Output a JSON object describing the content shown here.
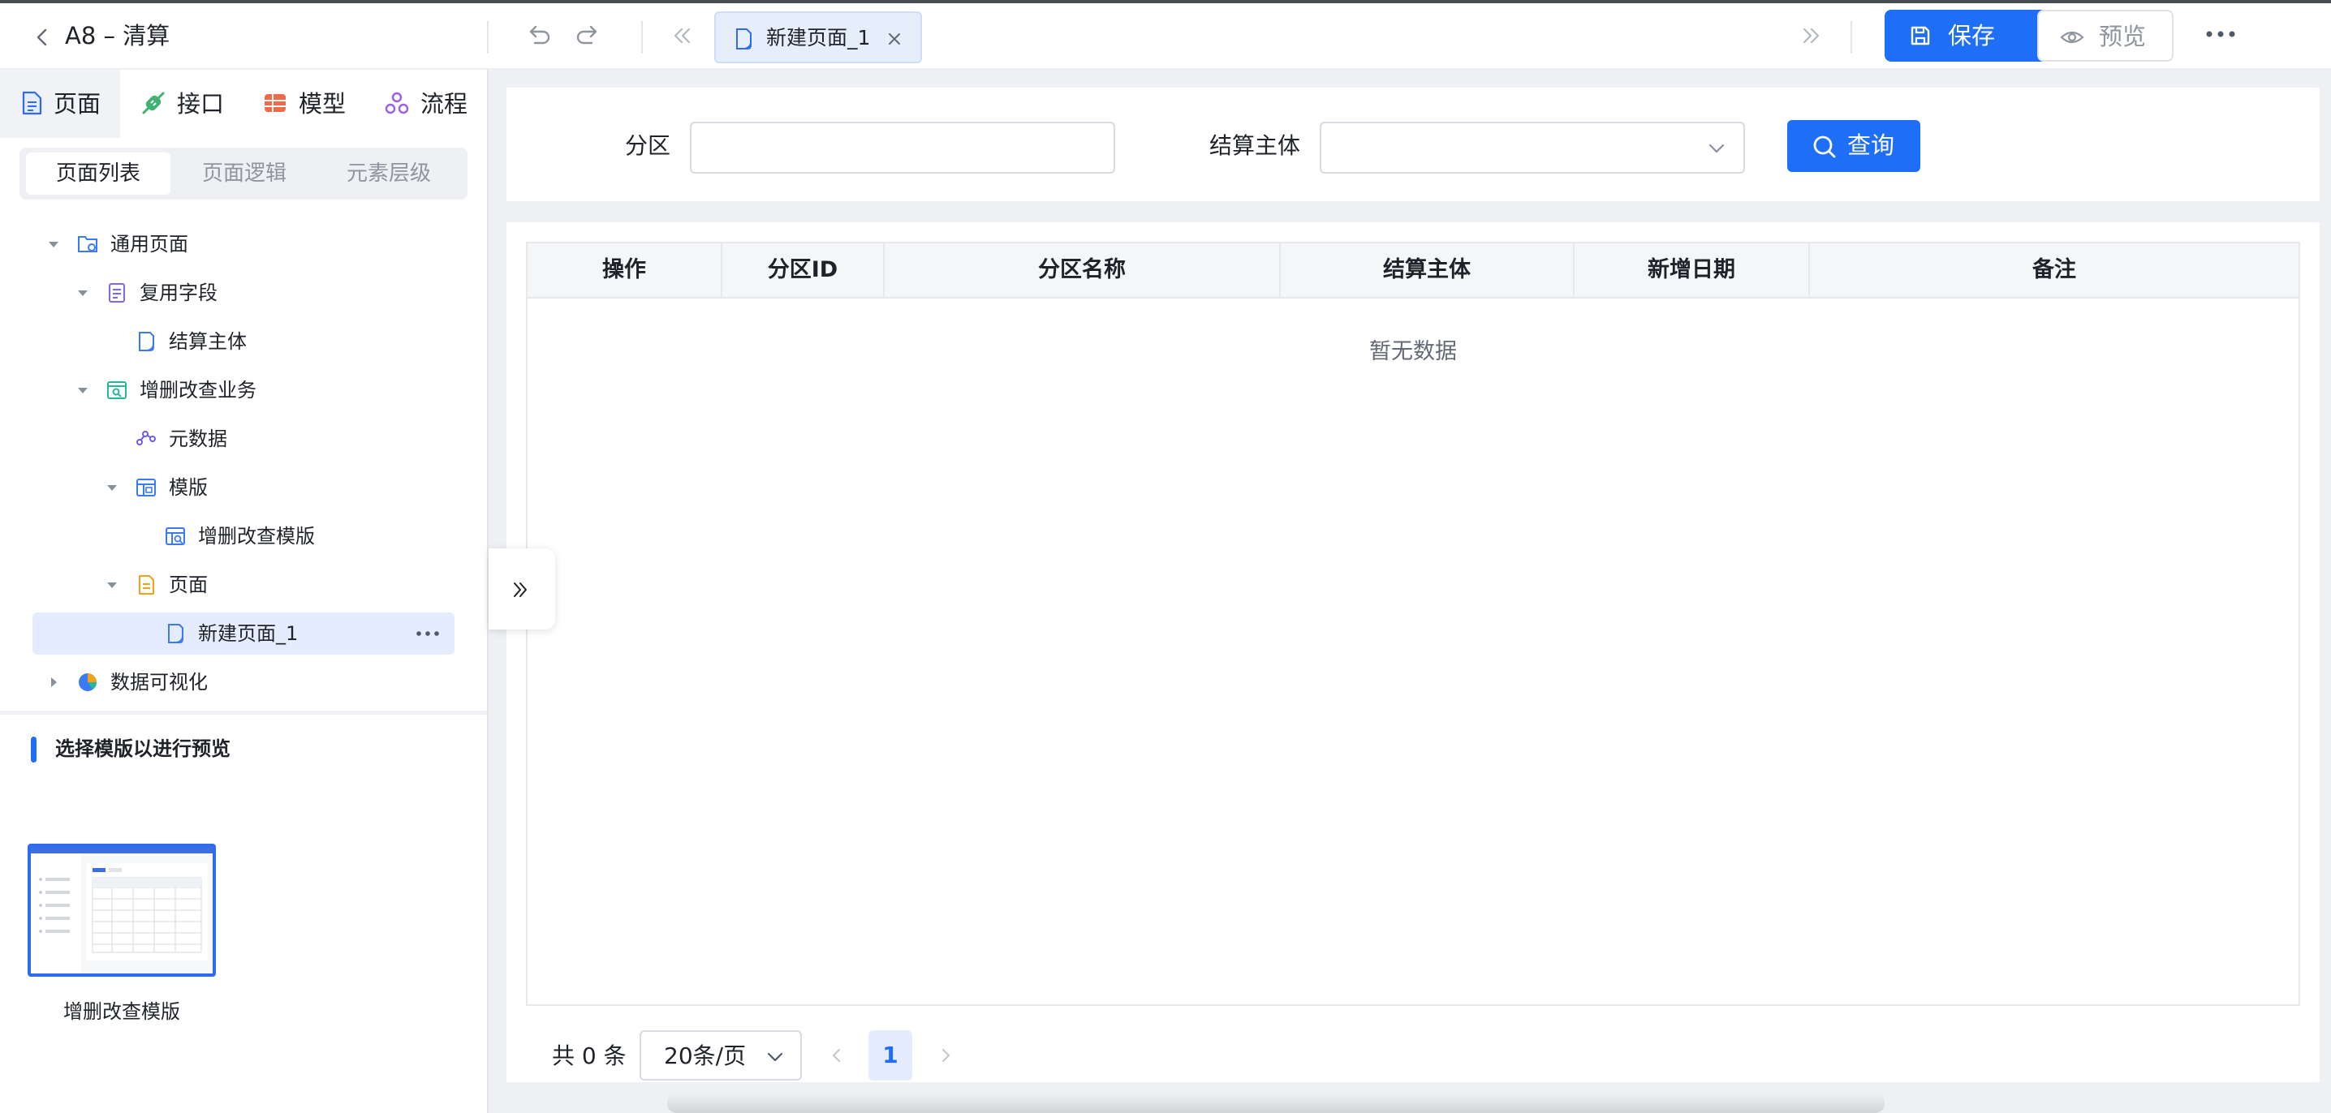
{
  "header": {
    "title": "A8 – 清算",
    "tab_label": "新建页面_1",
    "save_label": "保存",
    "preview_label": "预览"
  },
  "left_panel": {
    "nav_tabs": [
      {
        "label": "页面",
        "icon": "page-icon"
      },
      {
        "label": "接口",
        "icon": "api-icon"
      },
      {
        "label": "模型",
        "icon": "model-icon"
      },
      {
        "label": "流程",
        "icon": "flow-icon"
      }
    ],
    "sub_tabs": [
      "页面列表",
      "页面逻辑",
      "元素层级"
    ],
    "tree": [
      {
        "label": "通用页面",
        "icon": "folder-page-icon"
      },
      {
        "label": "复用字段",
        "icon": "doc-purple-icon"
      },
      {
        "label": "结算主体",
        "icon": "page-icon"
      },
      {
        "label": "增删改查业务",
        "icon": "crud-icon"
      },
      {
        "label": "元数据",
        "icon": "metadata-icon"
      },
      {
        "label": "模版",
        "icon": "template-icon"
      },
      {
        "label": "增删改查模版",
        "icon": "crud-template-icon"
      },
      {
        "label": "页面",
        "icon": "doc-orange-icon"
      },
      {
        "label": "新建页面_1",
        "icon": "page-icon"
      },
      {
        "label": "数据可视化",
        "icon": "pie-chart-icon"
      }
    ],
    "preview_heading": "选择模版以进行预览",
    "template_label": "增删改查模版"
  },
  "filter": {
    "partition_label": "分区",
    "partition_value": "",
    "entity_label": "结算主体",
    "entity_value": "",
    "query_label": "查询"
  },
  "table": {
    "columns": [
      "操作",
      "分区ID",
      "分区名称",
      "结算主体",
      "新增日期",
      "备注"
    ],
    "rows": [],
    "empty_text": "暂无数据"
  },
  "pagination": {
    "total_text": "共 0 条",
    "page_size": "20条/页",
    "current_page": "1"
  },
  "colors": {
    "primary": "#1f6ef7",
    "selected_bg": "#e4ecfd"
  }
}
